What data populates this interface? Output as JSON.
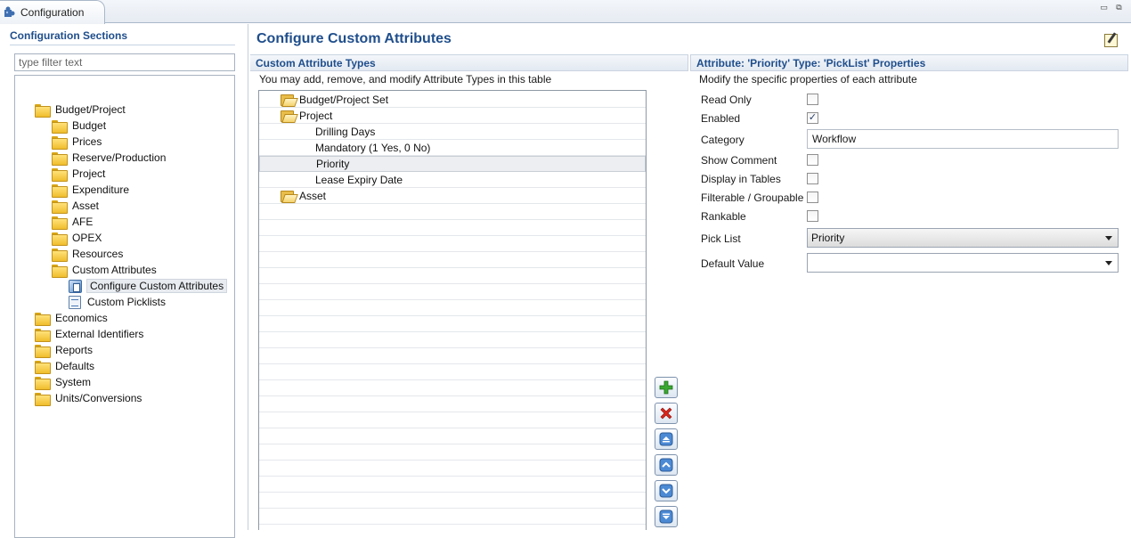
{
  "window": {
    "tab_title": "Configuration",
    "minimize_glyph": "▭",
    "maximize_glyph": "⧉"
  },
  "sidebar": {
    "title": "Configuration Sections",
    "filter_placeholder": "type filter text",
    "tree": [
      {
        "label": "Budget/Project",
        "icon": "folder-icon"
      },
      {
        "label": "Budget",
        "icon": "folder-icon"
      },
      {
        "label": "Prices",
        "icon": "folder-icon"
      },
      {
        "label": "Reserve/Production",
        "icon": "folder-icon"
      },
      {
        "label": "Project",
        "icon": "folder-icon"
      },
      {
        "label": "Expenditure",
        "icon": "folder-icon"
      },
      {
        "label": "Asset",
        "icon": "folder-icon"
      },
      {
        "label": "AFE",
        "icon": "folder-icon"
      },
      {
        "label": "OPEX",
        "icon": "folder-icon"
      },
      {
        "label": "Resources",
        "icon": "folder-icon"
      },
      {
        "label": "Custom Attributes",
        "icon": "folder-icon"
      },
      {
        "label": "Configure Custom Attributes",
        "icon": "config-icon",
        "selected": true
      },
      {
        "label": "Custom Picklists",
        "icon": "picklist-icon"
      },
      {
        "label": "Economics",
        "icon": "folder-icon"
      },
      {
        "label": "External Identifiers",
        "icon": "folder-icon"
      },
      {
        "label": "Reports",
        "icon": "folder-icon"
      },
      {
        "label": "Defaults",
        "icon": "folder-icon"
      },
      {
        "label": "System",
        "icon": "folder-icon"
      },
      {
        "label": "Units/Conversions",
        "icon": "folder-icon"
      }
    ]
  },
  "main": {
    "title": "Configure Custom Attributes",
    "types_pane": {
      "header": "Custom Attribute Types",
      "description": "You may add, remove, and modify Attribute Types in this table",
      "rows": [
        {
          "label": "Budget/Project Set",
          "icon": "open-folder-icon"
        },
        {
          "label": "Project",
          "icon": "open-folder-icon"
        },
        {
          "label": "Drilling Days"
        },
        {
          "label": "Mandatory (1 Yes, 0 No)"
        },
        {
          "label": "Priority",
          "selected": true
        },
        {
          "label": "Lease Expiry Date"
        },
        {
          "label": "Asset",
          "icon": "open-folder-icon"
        }
      ]
    },
    "toolbar_buttons": [
      {
        "name": "add-button",
        "icon": "plus-icon"
      },
      {
        "name": "delete-button",
        "icon": "delete-x-icon"
      },
      {
        "name": "move-top-button",
        "icon": "move-top-icon"
      },
      {
        "name": "move-up-button",
        "icon": "move-up-icon"
      },
      {
        "name": "move-down-button",
        "icon": "move-down-icon"
      },
      {
        "name": "move-bottom-button",
        "icon": "move-bottom-icon"
      }
    ],
    "properties_pane": {
      "header": "Attribute: 'Priority'  Type: 'PickList'  Properties",
      "description": "Modify the specific properties of each attribute",
      "fields": {
        "read_only": {
          "label": "Read Only",
          "checked": false
        },
        "enabled": {
          "label": "Enabled",
          "checked": true
        },
        "category": {
          "label": "Category",
          "value": "Workflow"
        },
        "show_comment": {
          "label": "Show Comment",
          "checked": false
        },
        "display_in_tables": {
          "label": "Display in Tables",
          "checked": false
        },
        "filterable": {
          "label": "Filterable / Groupable",
          "checked": false
        },
        "rankable": {
          "label": "Rankable",
          "checked": false
        },
        "pick_list": {
          "label": "Pick List",
          "value": "Priority"
        },
        "default_value": {
          "label": "Default Value",
          "value": ""
        }
      },
      "check_glyph": "✓"
    }
  }
}
